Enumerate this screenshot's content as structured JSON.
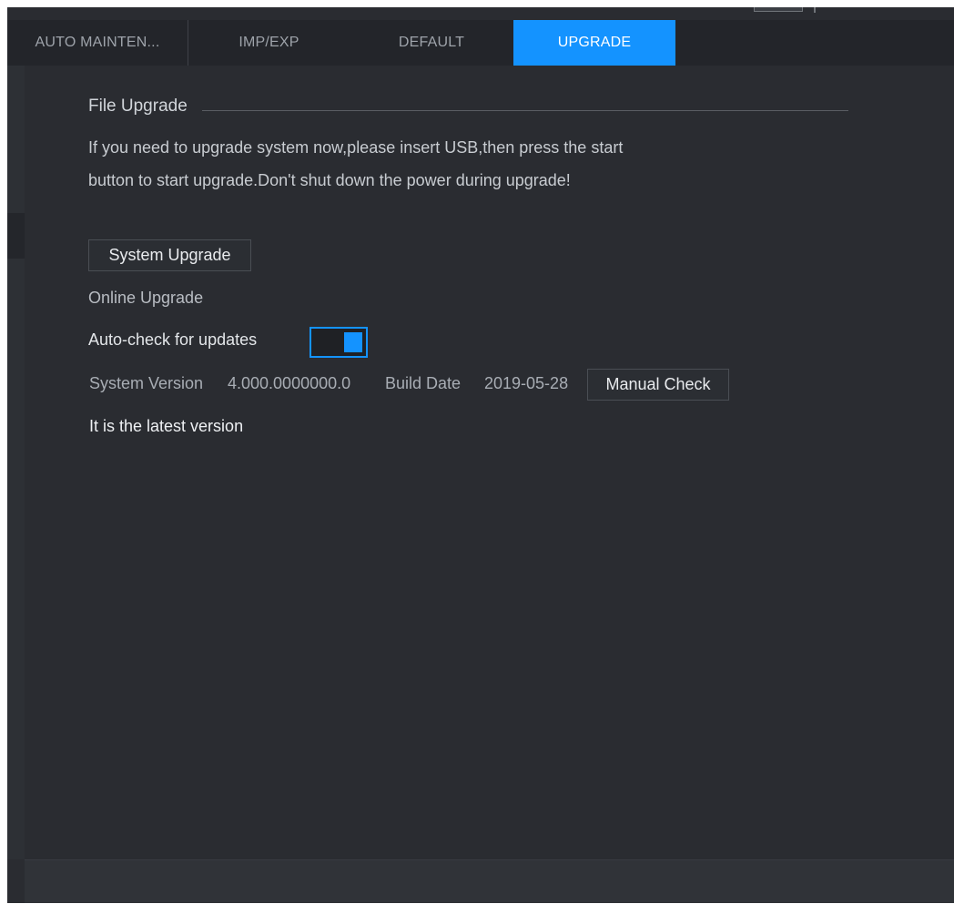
{
  "tabs": [
    {
      "label": "AUTO MAINTEN...",
      "active": false
    },
    {
      "label": "IMP/EXP",
      "active": false
    },
    {
      "label": "DEFAULT",
      "active": false
    },
    {
      "label": "UPGRADE",
      "active": true
    }
  ],
  "file_upgrade": {
    "title": "File Upgrade",
    "info_line1": "If you need to upgrade system now,please insert USB,then press the start",
    "info_line2": "button to start upgrade.Don't shut down the power during upgrade!",
    "button_label": "System Upgrade"
  },
  "online_upgrade": {
    "title": "Online Upgrade",
    "auto_check_label": "Auto-check for updates",
    "auto_check_enabled": true,
    "system_version_label": "System Version",
    "system_version_value": "4.000.0000000.0",
    "build_date_label": "Build Date",
    "build_date_value": "2019-05-28",
    "manual_check_label": "Manual Check",
    "status_text": "It is the latest version"
  },
  "colors": {
    "accent": "#1493ff",
    "panel": "#2a2c31",
    "tabbar": "#23252a",
    "text": "#c8ccd1"
  }
}
